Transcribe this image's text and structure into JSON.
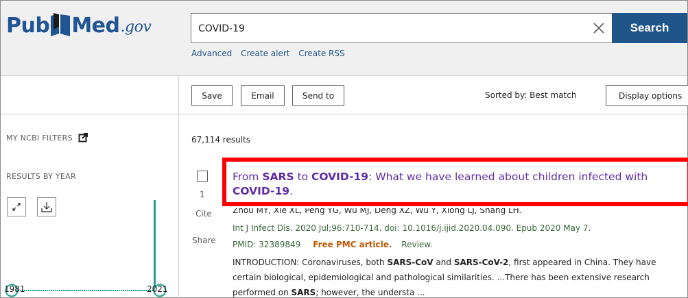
{
  "logo": {
    "part1": "Pub",
    "part2": "Med",
    "part3": ".gov"
  },
  "search": {
    "value": "COVID-19",
    "button_label": "Search",
    "clear_icon": "close-icon"
  },
  "search_links": [
    "Advanced",
    "Create alert",
    "Create RSS"
  ],
  "toolbar": {
    "save_label": "Save",
    "email_label": "Email",
    "send_to_label": "Send to",
    "sorted_by": "Sorted by: Best match",
    "display_options_label": "Display options"
  },
  "sidebar": {
    "ncbi_filters": "MY NCBI FILTERS",
    "results_by_year": "RESULTS BY YEAR",
    "year_start": "1981",
    "year_end": "2021"
  },
  "results": {
    "count": "67,114 results",
    "items": [
      {
        "number": "1",
        "cite_label": "Cite",
        "share_label": "Share",
        "title_parts": [
          {
            "text": "From ",
            "bold": false
          },
          {
            "text": "SARS",
            "bold": true
          },
          {
            "text": " to ",
            "bold": false
          },
          {
            "text": "COVID-19",
            "bold": true
          },
          {
            "text": ": What we have learned about children infected with ",
            "bold": false
          },
          {
            "text": "COVID-19",
            "bold": true
          },
          {
            "text": ".",
            "bold": false
          }
        ],
        "authors": "Zhou MY, Xie XL, Peng YG, Wu MJ, Deng XZ, Wu Y, Xiong LJ, Shang LH.",
        "citation": "Int J Infect Dis. 2020 Jul;96:710-714. doi: 10.1016/j.ijid.2020.04.090. Epub 2020 May 7.",
        "pmid": "PMID: 32389849",
        "free_pmc": "Free PMC article.",
        "review": "Review.",
        "snippet_parts": [
          {
            "text": "INTRODUCTION: Coronaviruses, both ",
            "bold": false
          },
          {
            "text": "SARS-CoV",
            "bold": true
          },
          {
            "text": " and ",
            "bold": false
          },
          {
            "text": "SARS-CoV-2",
            "bold": true
          },
          {
            "text": ", first appeared in China. They have certain biological, epidemiological and pathological similarities. ...There has been extensive research performed on ",
            "bold": false
          },
          {
            "text": "SARS",
            "bold": true
          },
          {
            "text": "; however, the understa ...",
            "bold": false
          }
        ]
      }
    ]
  },
  "colors": {
    "brand": "#205493",
    "search_button": "#20558a",
    "title_link": "#5e2ca5",
    "highlight": "#ff0000",
    "free_pmc": "#c05600",
    "timeline": "#20a090"
  }
}
